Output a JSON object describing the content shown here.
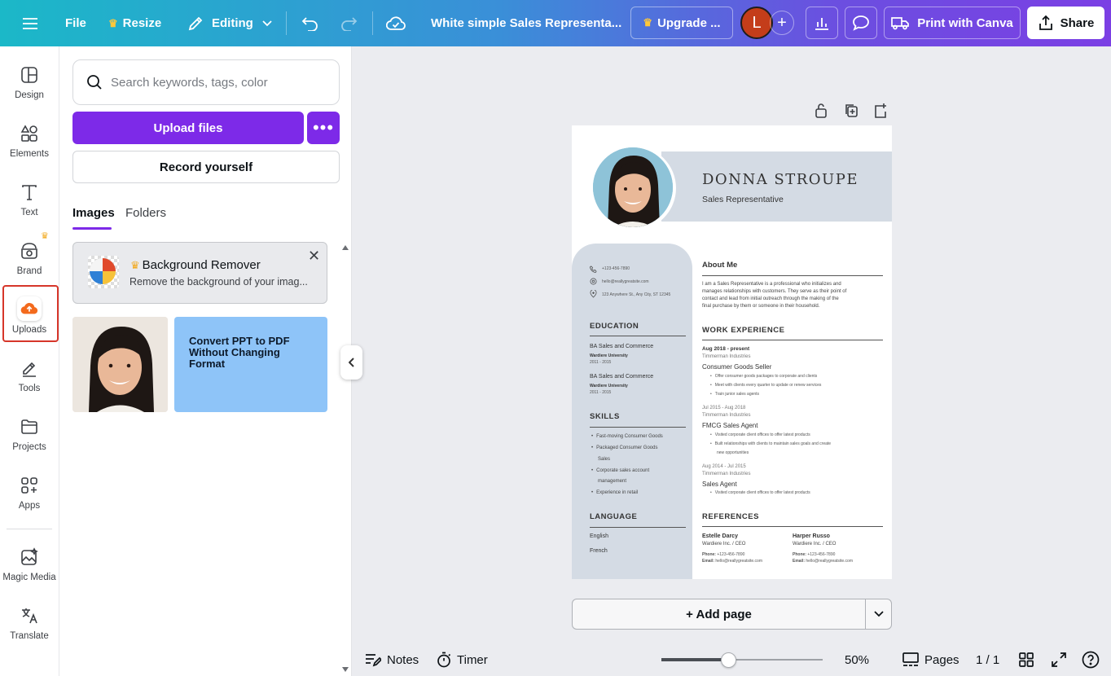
{
  "colors": {
    "accent": "#7d2ae8",
    "selection": "#d6362a",
    "resume_panel": "#d4dbe4",
    "promo_card": "#8ec4f8"
  },
  "topbar": {
    "file": "File",
    "resize": "Resize",
    "mode": "Editing",
    "title": "White simple Sales Representa...",
    "upgrade": "Upgrade ...",
    "avatar_initial": "L",
    "print": "Print with Canva",
    "share": "Share"
  },
  "rail": {
    "design": "Design",
    "elements": "Elements",
    "text": "Text",
    "brand": "Brand",
    "uploads": "Uploads",
    "tools": "Tools",
    "projects": "Projects",
    "apps": "Apps",
    "magic_media": "Magic Media",
    "translate": "Translate"
  },
  "panel": {
    "search_placeholder": "Search keywords, tags, color",
    "upload_btn": "Upload files",
    "record_btn": "Record yourself",
    "tab_images": "Images",
    "tab_folders": "Folders",
    "promo_title": "Background Remover",
    "promo_desc": "Remove the background of your imag...",
    "ppt_card": "Convert PPT to PDF Without Changing Format"
  },
  "resume": {
    "name": "DONNA STROUPE",
    "role": "Sales Representative",
    "phone": "+123-456-7890",
    "email": "hello@reallygreatsite.com",
    "address": "123 Anywhere St., Any City, ST 12345",
    "education_head": "EDUCATION",
    "edu1_degree": "BA Sales and Commerce",
    "edu1_school": "Wardiere University",
    "edu1_years": "2011 - 2015",
    "edu2_degree": "BA Sales and Commerce",
    "edu2_school": "Wardiere University",
    "edu2_years": "2011 - 2015",
    "skills_head": "SKILLS",
    "skill1": "Fast-moving Consumer Goods",
    "skill2a": "Packaged Consumer Goods",
    "skill2b": "Sales",
    "skill3a": "Corporate sales account",
    "skill3b": "management",
    "skill4": "Experience in retail",
    "language_head": "LANGUAGE",
    "lang1": "English",
    "lang2": "French",
    "about_head": "About Me",
    "about1": "I am a Sales Representative is a professional who initializes and",
    "about2": "manages relationships with customers. They serve as their point of",
    "about3": "contact and lead from initial outreach through the making of the",
    "about4": "final purchase by them or someone in their household.",
    "work_head": "WORK EXPERIENCE",
    "job1_date": "Aug 2018 - present",
    "job1_company": "Timmerman Industries",
    "job1_title": "Consumer Goods Seller",
    "job1_b1": "Offer consumer goods packages to corporate and clients",
    "job1_b2": "Meet with clients every quarter to update or renew services",
    "job1_b3": "Train junior sales agents",
    "job2_date": "Jul 2015 - Aug 2018",
    "job2_company": "Timmerman Industries",
    "job2_title": "FMCG Sales Agent",
    "job2_b1": "Visited corporate client offices to offer latest products",
    "job2_b2a": "Built relationships with clients to maintain sales goals and create",
    "job2_b2b": "new opportunities",
    "job3_date": "Aug 2014 - Jul 2015",
    "job3_company": "Timmerman Industries",
    "job3_title": "Sales Agent",
    "job3_b1": "Visited corporate client offices to offer latest products",
    "refs_head": "REFERENCES",
    "ref1_name": "Estelle Darcy",
    "ref1_role": "Wardiere Inc. / CEO",
    "ref1_phone_label": "Phone:",
    "ref1_phone": "+123-456-7890",
    "ref1_email_label": "Email:",
    "ref1_email": "hello@reallygreatsite.com",
    "ref2_name": "Harper Russo",
    "ref2_role": "Wardiere Inc. / CEO",
    "ref2_phone_label": "Phone:",
    "ref2_phone": "+123-456-7890",
    "ref2_email_label": "Email:",
    "ref2_email": "hello@reallygreatsite.com"
  },
  "canvas": {
    "add_page": "+ Add page"
  },
  "bottombar": {
    "notes": "Notes",
    "timer": "Timer",
    "zoom": "50%",
    "zoom_fraction": 0.42,
    "pages": "Pages",
    "page_count": "1 / 1"
  }
}
